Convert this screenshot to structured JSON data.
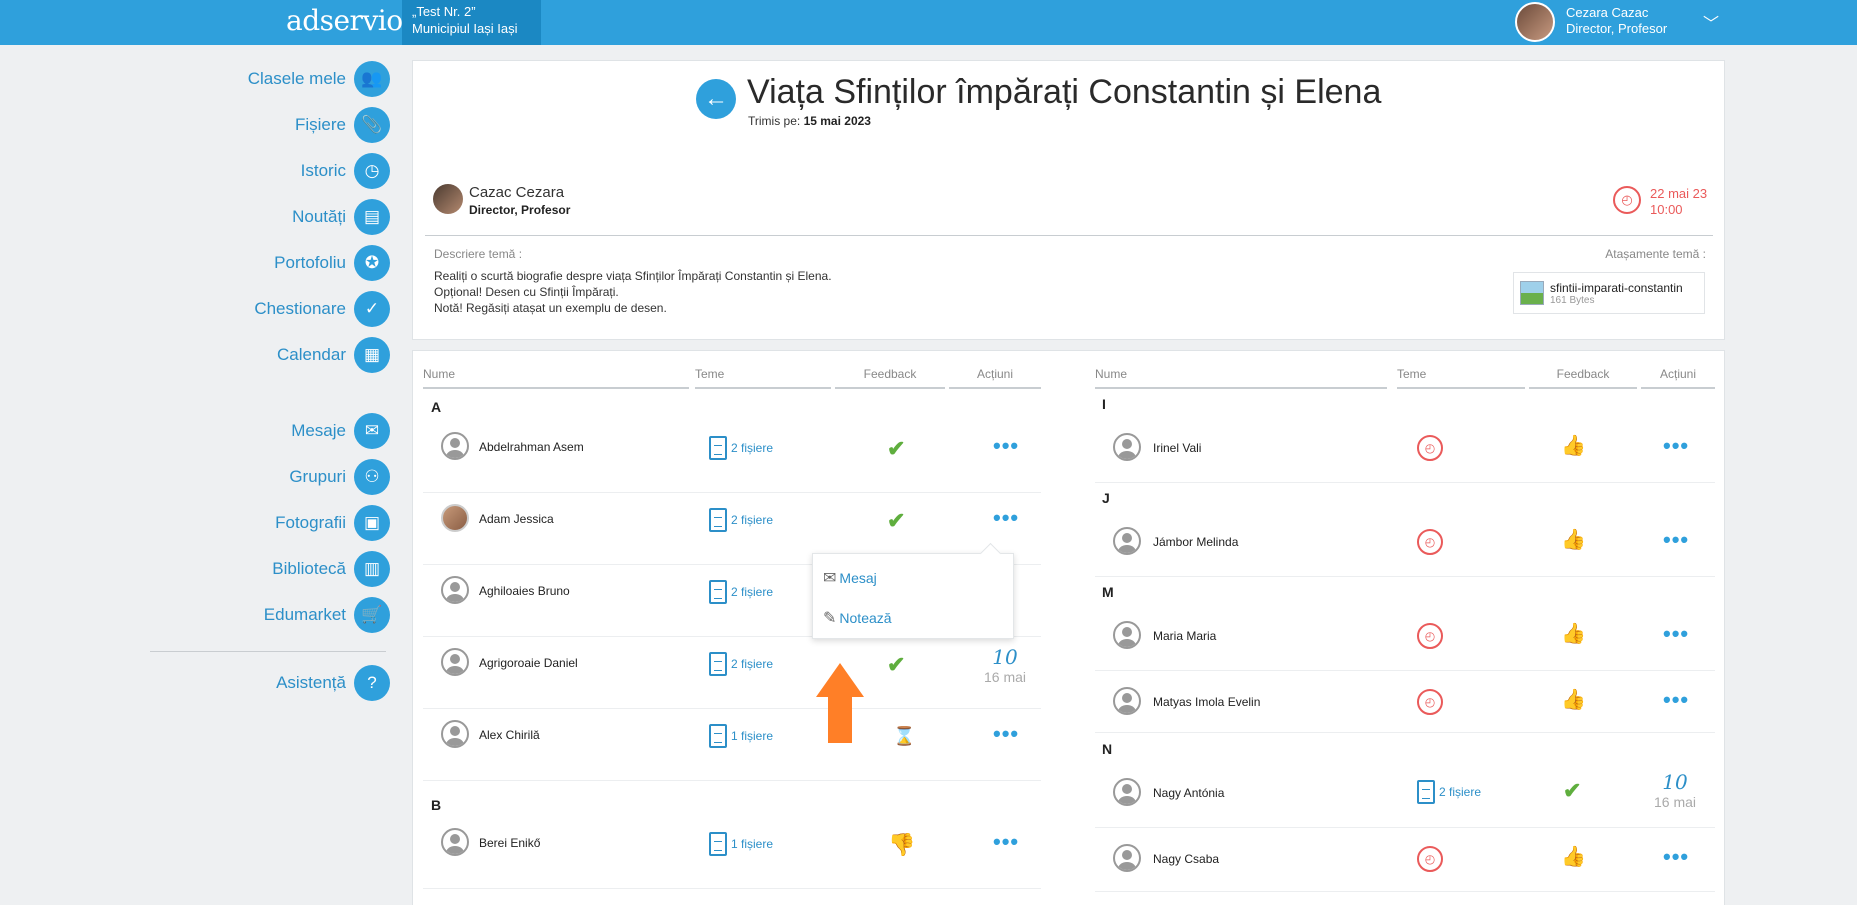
{
  "topbar": {
    "logo": "adservio",
    "school_line1": "„Test Nr. 2”",
    "school_line2": "Municipiul Iași Iași",
    "user_name": "Cezara Cazac",
    "user_role": "Director, Profesor"
  },
  "sidebar": {
    "items": [
      {
        "label": "Clasele mele",
        "icon": "users-icon"
      },
      {
        "label": "Fișiere",
        "icon": "paperclip-icon"
      },
      {
        "label": "Istoric",
        "icon": "history-icon"
      },
      {
        "label": "Noutăți",
        "icon": "news-icon"
      },
      {
        "label": "Portofoliu",
        "icon": "portfolio-icon"
      },
      {
        "label": "Chestionare",
        "icon": "checklist-icon"
      },
      {
        "label": "Calendar",
        "icon": "calendar-icon"
      },
      {
        "label": "Mesaje",
        "icon": "envelope-icon"
      },
      {
        "label": "Grupuri",
        "icon": "groups-icon"
      },
      {
        "label": "Fotografii",
        "icon": "photos-icon"
      },
      {
        "label": "Bibliotecă",
        "icon": "library-icon"
      },
      {
        "label": "Edumarket",
        "icon": "cart-icon"
      },
      {
        "label": "Asistență",
        "icon": "help-icon"
      }
    ]
  },
  "assignment": {
    "title": "Viața Sfinților împărați Constantin și Elena",
    "sent_label": "Trimis pe:",
    "sent_date": "15 mai 2023",
    "author_name": "Cazac Cezara",
    "author_role": "Director, Profesor",
    "deadline_date": "22 mai 23",
    "deadline_time": "10:00",
    "description_label": "Descriere temă :",
    "description_lines": [
      "Realiți o scurtă biografie despre viața Sfinților Împărați Constantin și Elena.",
      "Opțional! Desen cu Sfinții Împărați.",
      "Notă! Regăsiți atașat un exemplu de desen."
    ],
    "attachments_label": "Atașamente temă :",
    "attachment": {
      "name": "sfintii-imparati-constantin",
      "size": "161 Bytes"
    }
  },
  "columns": {
    "name": "Nume",
    "homework": "Teme",
    "feedback": "Feedback",
    "actions": "Acțiuni"
  },
  "left_list": {
    "letters": [
      "A",
      "B"
    ],
    "students": [
      {
        "name": "Abdelrahman Asem",
        "files": "2 fișiere",
        "feedback": "check"
      },
      {
        "name": "Adam Jessica",
        "files": "2 fișiere",
        "feedback": "check"
      },
      {
        "name": "Aghiloaies Bruno",
        "files": "2 fișiere",
        "feedback": ""
      },
      {
        "name": "Agrigoroaie Daniel",
        "files": "2 fișiere",
        "feedback": "check",
        "grade": "10",
        "grade_date": "16 mai"
      },
      {
        "name": "Alex Chirilă",
        "files": "1 fișiere",
        "feedback": "pending"
      },
      {
        "name": "Berei Enikő",
        "files": "1 fișiere",
        "feedback": "thumbs-down"
      }
    ]
  },
  "right_list": {
    "letters": [
      "I",
      "J",
      "M",
      "N"
    ],
    "students": [
      {
        "name": "Irinel Vali"
      },
      {
        "name": "Jámbor Melinda"
      },
      {
        "name": "Maria Maria"
      },
      {
        "name": "Matyas Imola Evelin"
      },
      {
        "name": "Nagy Antónia",
        "files": "2 fișiere",
        "grade": "10",
        "grade_date": "16 mai"
      },
      {
        "name": "Nagy Csaba"
      }
    ]
  },
  "popup": {
    "message": "Mesaj",
    "grade": "Notează"
  },
  "colors": {
    "primary": "#2fa0dc",
    "danger": "#ea5a5a",
    "success": "#5fae3e",
    "annotation": "#ff7f27"
  }
}
